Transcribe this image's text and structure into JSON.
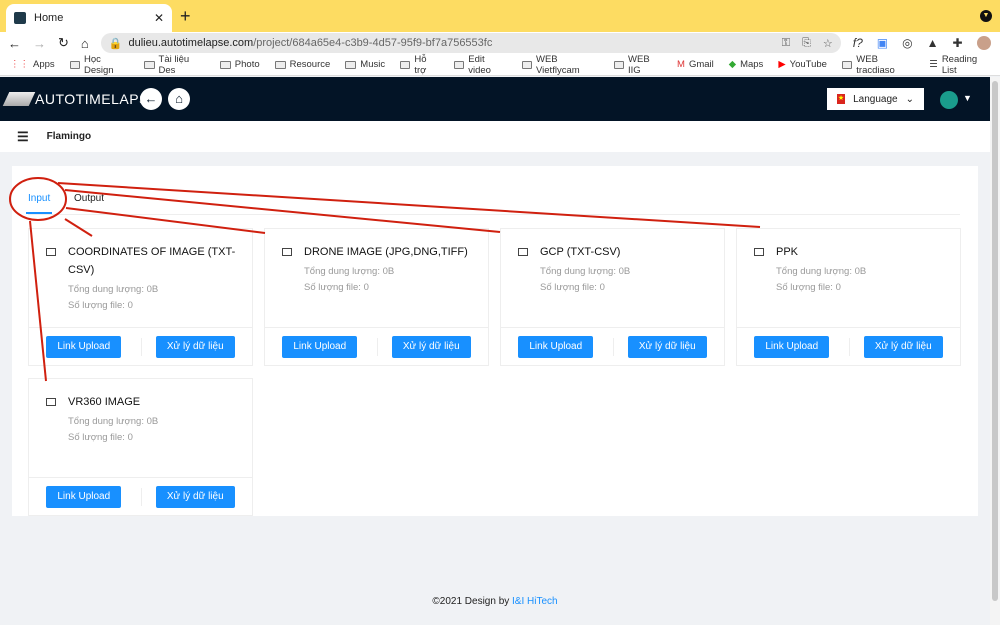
{
  "browser": {
    "tab_title": "Home",
    "url_host": "dulieu.autotimelapse.com",
    "url_path": "/project/684a65e4-c3b9-4d57-95f9-bf7a756553fc",
    "bookmarks": [
      "Apps",
      "Học Design",
      "Tài liệu Des",
      "Photo",
      "Resource",
      "Music",
      "Hỗ trợ",
      "Edit video",
      "WEB Vietflycam",
      "WEB IIG",
      "Gmail",
      "Maps",
      "YouTube",
      "WEB tracdiaso"
    ],
    "reading_list": "Reading List"
  },
  "header": {
    "logo": "AUTOTIMELAPSE",
    "language": "Language"
  },
  "project": {
    "name": "Flamingo"
  },
  "tabs": [
    {
      "label": "Input",
      "active": true
    },
    {
      "label": "Output",
      "active": false
    }
  ],
  "cards": [
    {
      "title": "COORDINATES OF IMAGE (TXT-CSV)",
      "size": "Tổng dung lượng: 0B",
      "count": "Số lượng file: 0",
      "upload": "Link Upload",
      "process": "Xử lý dữ liệu"
    },
    {
      "title": "DRONE IMAGE (JPG,DNG,TIFF)",
      "size": "Tổng dung lượng: 0B",
      "count": "Số lượng file: 0",
      "upload": "Link Upload",
      "process": "Xử lý dữ liệu"
    },
    {
      "title": "GCP (TXT-CSV)",
      "size": "Tổng dung lượng: 0B",
      "count": "Số lượng file: 0",
      "upload": "Link Upload",
      "process": "Xử lý dữ liệu"
    },
    {
      "title": "PPK",
      "size": "Tổng dung lượng: 0B",
      "count": "Số lượng file: 0",
      "upload": "Link Upload",
      "process": "Xử lý dữ liệu"
    },
    {
      "title": "VR360 IMAGE",
      "size": "Tổng dung lượng: 0B",
      "count": "Số lượng file: 0",
      "upload": "Link Upload",
      "process": "Xử lý dữ liệu"
    }
  ],
  "footer": {
    "text": "©2021 Design by ",
    "link": "I&I HiTech"
  },
  "colors": {
    "accent": "#1890ff",
    "header_bg": "#031426",
    "annotation": "#d0200f"
  }
}
